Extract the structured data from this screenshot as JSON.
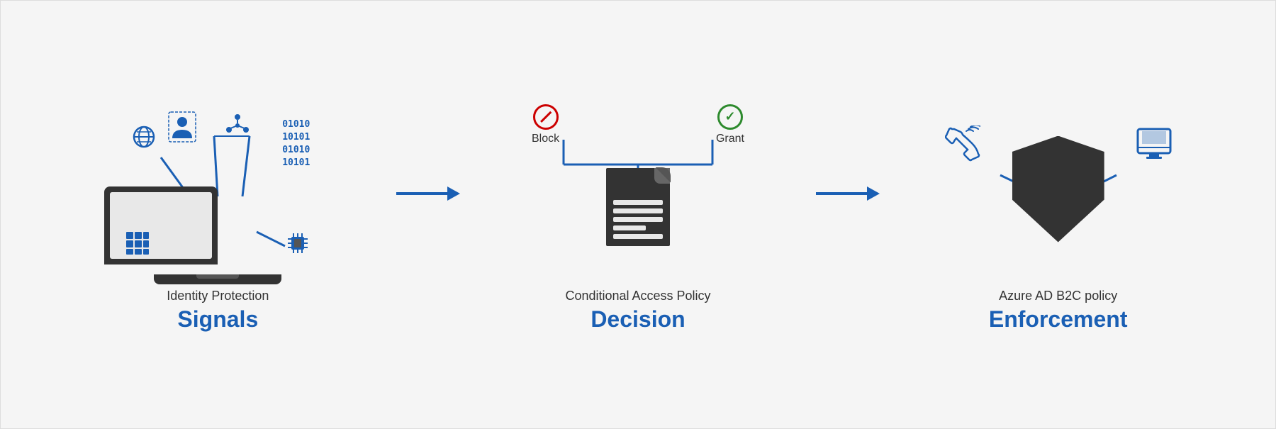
{
  "sections": [
    {
      "id": "signals",
      "sub_label": "Identity Protection",
      "main_label": "Signals"
    },
    {
      "id": "decision",
      "sub_label": "Conditional Access Policy",
      "main_label": "Decision",
      "block_label": "Block",
      "grant_label": "Grant"
    },
    {
      "id": "enforcement",
      "sub_label": "Azure AD B2C policy",
      "main_label": "Enforcement"
    }
  ],
  "arrow": "→",
  "colors": {
    "blue": "#1a5fb4",
    "dark": "#333333",
    "block_red": "#cc0000",
    "grant_green": "#2d8a2d"
  }
}
